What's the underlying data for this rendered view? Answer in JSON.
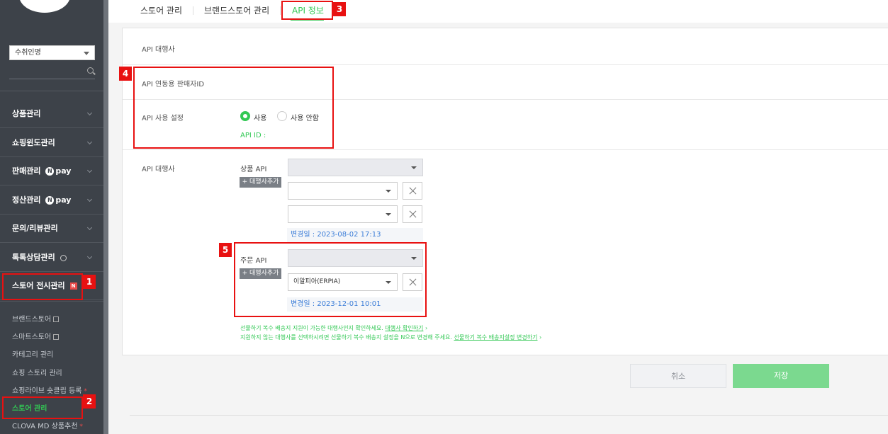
{
  "sidebar": {
    "store_select": "수취인명",
    "menu": [
      {
        "label": "상품관리"
      },
      {
        "label": "쇼핑윈도관리"
      },
      {
        "label": "판매관리",
        "pay": "pay"
      },
      {
        "label": "정산관리",
        "pay": "pay"
      },
      {
        "label": "문의/리뷰관리"
      },
      {
        "label": "톡톡상담관리"
      },
      {
        "label": "스토어 전시관리",
        "badge": "N"
      }
    ],
    "sub_items": [
      {
        "label": "브랜드스토어"
      },
      {
        "label": "스마트스토어"
      },
      {
        "label": "카테고리 관리"
      },
      {
        "label": "쇼핑 스토리 관리"
      },
      {
        "label": "쇼핑라이브 숏클립 등록",
        "star": "*"
      },
      {
        "label": "스토어 관리"
      },
      {
        "label": "CLOVA MD 상품추천",
        "star": "*"
      }
    ]
  },
  "tabs": [
    {
      "label": "스토어 관리"
    },
    {
      "label": "브랜드스토어 관리"
    },
    {
      "label": "API 정보"
    }
  ],
  "form": {
    "api_agency_label": "API 대행사",
    "seller_id_label": "API 연동용 판매자ID",
    "api_use_label": "API 사용 설정",
    "use_option": "사용",
    "no_use_option": "사용 안함",
    "api_id_label": "API ID :",
    "api_agency_label2": "API 대행사",
    "product_api_label": "상품 API",
    "add_agency_label": "+ 대행사추가",
    "product_changed": "변경일 : 2023-08-02 17:13",
    "order_api_label": "주문 API",
    "order_selected_agency": "이알피아(ERPIA)",
    "order_changed": "변경일 : 2023-12-01 10:01",
    "note1_text": "선물하기 복수 배송지 지원이 가능한 대행사인지 확인하세요.",
    "note1_link": "대행사 확인하기",
    "note2_text": "지원하지 않는 대행사를 선택하시려면 선물하기 복수 배송지 설정을 N으로 변경해 주세요.",
    "note2_link": "선물하기 복수 배송지설정 변경하기"
  },
  "buttons": {
    "cancel": "취소",
    "save": "저장"
  },
  "annotations": [
    "1",
    "2",
    "3",
    "4",
    "5"
  ],
  "colors": {
    "accent": "#32c854",
    "highlight": "#e81111",
    "sidebar_bg": "#3d4249"
  }
}
